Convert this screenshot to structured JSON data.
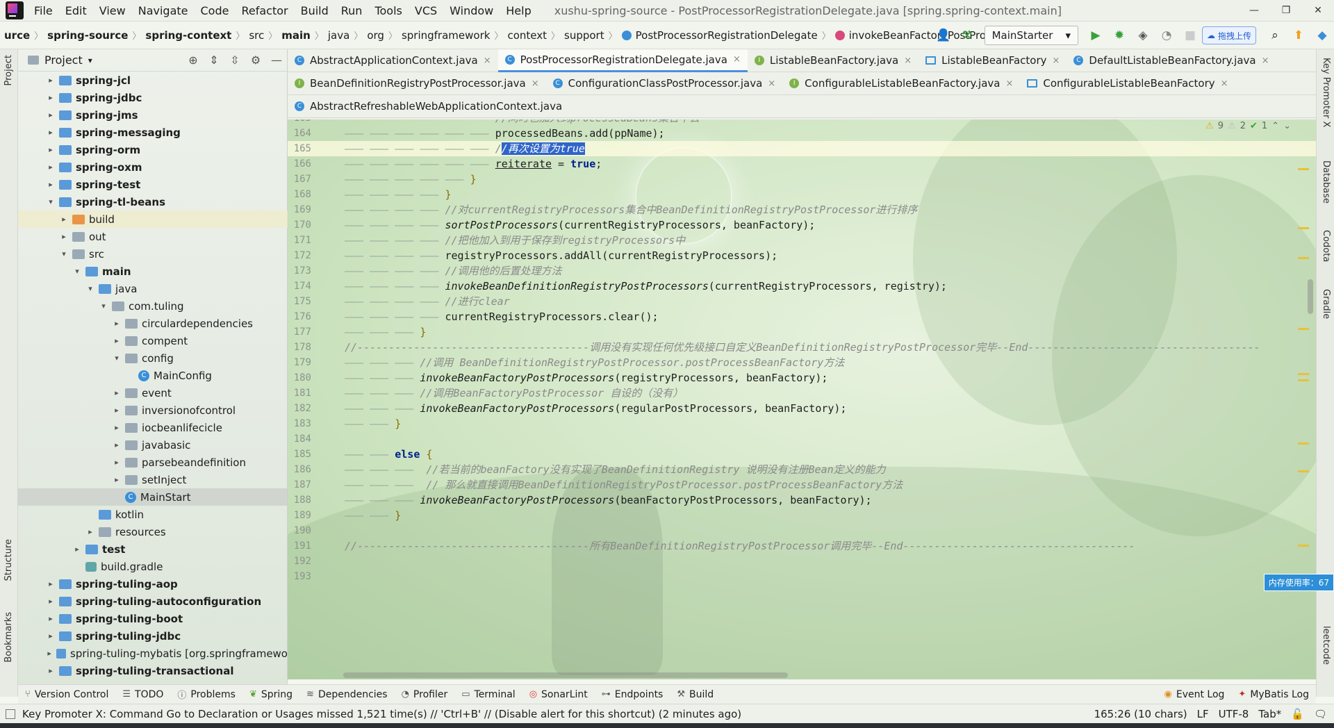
{
  "menu": {
    "items": [
      "File",
      "Edit",
      "View",
      "Navigate",
      "Code",
      "Refactor",
      "Build",
      "Run",
      "Tools",
      "VCS",
      "Window",
      "Help"
    ],
    "window_title": "xushu-spring-source - PostProcessorRegistrationDelegate.java [spring.spring-context.main]"
  },
  "nav": {
    "crumbs": [
      "urce",
      "spring-source",
      "spring-context",
      "src",
      "main",
      "java",
      "org",
      "springframework",
      "context",
      "support"
    ],
    "class_crumb": "PostProcessorRegistrationDelegate",
    "method_crumb": "invokeBeanFactoryPostProcessors",
    "run_config": "MainStarter",
    "baidu_label": "拖拽上传"
  },
  "project": {
    "title": "Project",
    "items": [
      {
        "label": "spring-jcl",
        "level": 1,
        "arrow": "▸",
        "icon": "mod",
        "bold": true
      },
      {
        "label": "spring-jdbc",
        "level": 1,
        "arrow": "▸",
        "icon": "mod",
        "bold": true
      },
      {
        "label": "spring-jms",
        "level": 1,
        "arrow": "▸",
        "icon": "mod",
        "bold": true
      },
      {
        "label": "spring-messaging",
        "level": 1,
        "arrow": "▸",
        "icon": "mod",
        "bold": true
      },
      {
        "label": "spring-orm",
        "level": 1,
        "arrow": "▸",
        "icon": "mod",
        "bold": true
      },
      {
        "label": "spring-oxm",
        "level": 1,
        "arrow": "▸",
        "icon": "mod",
        "bold": true
      },
      {
        "label": "spring-test",
        "level": 1,
        "arrow": "▸",
        "icon": "mod",
        "bold": true
      },
      {
        "label": "spring-tl-beans",
        "level": 1,
        "arrow": "▾",
        "icon": "mod",
        "bold": true
      },
      {
        "label": "build",
        "level": 2,
        "arrow": "▸",
        "icon": "orange",
        "bold": false,
        "highlight": true
      },
      {
        "label": "out",
        "level": 2,
        "arrow": "▸",
        "icon": "plain",
        "bold": false
      },
      {
        "label": "src",
        "level": 2,
        "arrow": "▾",
        "icon": "plain",
        "bold": false
      },
      {
        "label": "main",
        "level": 3,
        "arrow": "▾",
        "icon": "src",
        "bold": true
      },
      {
        "label": "java",
        "level": 4,
        "arrow": "▾",
        "icon": "src",
        "bold": false
      },
      {
        "label": "com.tuling",
        "level": 5,
        "arrow": "▾",
        "icon": "plain",
        "bold": false
      },
      {
        "label": "circulardependencies",
        "level": 6,
        "arrow": "▸",
        "icon": "plain",
        "bold": false
      },
      {
        "label": "compent",
        "level": 6,
        "arrow": "▸",
        "icon": "plain",
        "bold": false
      },
      {
        "label": "config",
        "level": 6,
        "arrow": "▾",
        "icon": "plain",
        "bold": false
      },
      {
        "label": "MainConfig",
        "level": 7,
        "arrow": "",
        "icon": "class",
        "bold": false
      },
      {
        "label": "event",
        "level": 6,
        "arrow": "▸",
        "icon": "plain",
        "bold": false
      },
      {
        "label": "inversionofcontrol",
        "level": 6,
        "arrow": "▸",
        "icon": "plain",
        "bold": false
      },
      {
        "label": "iocbeanlifecicle",
        "level": 6,
        "arrow": "▸",
        "icon": "plain",
        "bold": false
      },
      {
        "label": "javabasic",
        "level": 6,
        "arrow": "▸",
        "icon": "plain",
        "bold": false
      },
      {
        "label": "parsebeandefinition",
        "level": 6,
        "arrow": "▸",
        "icon": "plain",
        "bold": false
      },
      {
        "label": "setInject",
        "level": 6,
        "arrow": "▸",
        "icon": "plain",
        "bold": false
      },
      {
        "label": "MainStart",
        "level": 6,
        "arrow": "",
        "icon": "class",
        "bold": false,
        "selected": true
      },
      {
        "label": "kotlin",
        "level": 4,
        "arrow": "",
        "icon": "src",
        "bold": false
      },
      {
        "label": "resources",
        "level": 4,
        "arrow": "▸",
        "icon": "res",
        "bold": false
      },
      {
        "label": "test",
        "level": 3,
        "arrow": "▸",
        "icon": "src",
        "bold": true
      },
      {
        "label": "build.gradle",
        "level": 3,
        "arrow": "",
        "icon": "gradle",
        "bold": false
      },
      {
        "label": "spring-tuling-aop",
        "level": 1,
        "arrow": "▸",
        "icon": "mod",
        "bold": true
      },
      {
        "label": "spring-tuling-autoconfiguration",
        "level": 1,
        "arrow": "▸",
        "icon": "mod",
        "bold": true
      },
      {
        "label": "spring-tuling-boot",
        "level": 1,
        "arrow": "▸",
        "icon": "mod",
        "bold": true
      },
      {
        "label": "spring-tuling-jdbc",
        "level": 1,
        "arrow": "▸",
        "icon": "mod",
        "bold": true
      },
      {
        "label": "spring-tuling-mybatis [org.springframewo",
        "level": 1,
        "arrow": "▸",
        "icon": "mod",
        "bold": false
      },
      {
        "label": "spring-tuling-transactional",
        "level": 1,
        "arrow": "▸",
        "icon": "mod",
        "bold": true
      }
    ]
  },
  "tabs": {
    "row1": [
      {
        "label": "AbstractApplicationContext.java",
        "icon": "class"
      },
      {
        "label": "PostProcessorRegistrationDelegate.java",
        "icon": "class",
        "active": true
      },
      {
        "label": "ListableBeanFactory.java",
        "icon": "iface"
      },
      {
        "label": "ListableBeanFactory",
        "icon": "diagram",
        "close": true
      },
      {
        "label": "DefaultListableBeanFactory.java",
        "icon": "class"
      }
    ],
    "row2": [
      {
        "label": "BeanDefinitionRegistryPostProcessor.java",
        "icon": "iface"
      },
      {
        "label": "ConfigurationClassPostProcessor.java",
        "icon": "class"
      },
      {
        "label": "ConfigurableListableBeanFactory.java",
        "icon": "iface"
      },
      {
        "label": "ConfigurableListableBeanFactory",
        "icon": "diagram"
      }
    ],
    "row3": [
      {
        "label": "AbstractRefreshableWebApplicationContext.java",
        "icon": "class",
        "noclose": true
      }
    ]
  },
  "editor": {
    "inspections": {
      "warnings": "9",
      "weak": "2",
      "ok": "1"
    },
    "lines": [
      {
        "n": "163",
        "indent": 6,
        "html": "<span class='cm'>//同时也加入到processedBeans集合中去</span>"
      },
      {
        "n": "164",
        "indent": 6,
        "html": "processedBeans.add(ppName);"
      },
      {
        "n": "165",
        "indent": 6,
        "html": "<span class='cm'>/</span><span class='sel cm'>/再次设置为true</span>",
        "current": true
      },
      {
        "n": "166",
        "indent": 6,
        "html": "<span class='under'>reiterate</span> = <span class='kw'>true</span>;"
      },
      {
        "n": "167",
        "indent": 5,
        "html": "<span class='brace'>}</span>"
      },
      {
        "n": "168",
        "indent": 4,
        "html": "<span class='brace'>}</span>"
      },
      {
        "n": "169",
        "indent": 4,
        "html": "<span class='cm'>//对currentRegistryProcessors集合中BeanDefinitionRegistryPostProcessor进行排序</span>"
      },
      {
        "n": "170",
        "indent": 4,
        "html": "<span class='fn'>sortPostProcessors</span>(currentRegistryProcessors, beanFactory);"
      },
      {
        "n": "171",
        "indent": 4,
        "html": "<span class='cm'>//把他加入到用于保存到registryProcessors中</span>"
      },
      {
        "n": "172",
        "indent": 4,
        "html": "registryProcessors.addAll(currentRegistryProcessors);"
      },
      {
        "n": "173",
        "indent": 4,
        "html": "<span class='cm'>//调用他的后置处理方法</span>"
      },
      {
        "n": "174",
        "indent": 4,
        "html": "<span class='fn'>invokeBeanDefinitionRegistryPostProcessors</span>(currentRegistryProcessors, registry);"
      },
      {
        "n": "175",
        "indent": 4,
        "html": "<span class='cm'>//进行clear</span>"
      },
      {
        "n": "176",
        "indent": 4,
        "html": "currentRegistryProcessors.clear();"
      },
      {
        "n": "177",
        "indent": 3,
        "html": "<span class='brace'>}</span>"
      },
      {
        "n": "178",
        "indent": 0,
        "html": "<span class='cm'>//-------------------------------------调用没有实现任何优先级接口自定义BeanDefinitionRegistryPostProcessor完毕--End-------------------------------------</span>"
      },
      {
        "n": "179",
        "indent": 3,
        "html": "<span class='cm'>//调用 BeanDefinitionRegistryPostProcessor.postProcessBeanFactory方法</span>"
      },
      {
        "n": "180",
        "indent": 3,
        "html": "<span class='fn'>invokeBeanFactoryPostProcessors</span>(registryProcessors, beanFactory);"
      },
      {
        "n": "181",
        "indent": 3,
        "html": "<span class='cm'>//调用BeanFactoryPostProcessor 自设的（没有）</span>"
      },
      {
        "n": "182",
        "indent": 3,
        "html": "<span class='fn'>invokeBeanFactoryPostProcessors</span>(regularPostProcessors, beanFactory);"
      },
      {
        "n": "183",
        "indent": 2,
        "html": "<span class='brace'>}</span>"
      },
      {
        "n": "184",
        "indent": 0,
        "html": ""
      },
      {
        "n": "185",
        "indent": 2,
        "html": "<span class='kw'>else</span> <span class='brace'>{</span>"
      },
      {
        "n": "186",
        "indent": 3,
        "html": " <span class='cm'>//若当前的beanFactory没有实现了BeanDefinitionRegistry 说明没有注册Bean定义的能力</span>"
      },
      {
        "n": "187",
        "indent": 3,
        "html": " <span class='cm'>// 那么就直接调用BeanDefinitionRegistryPostProcessor.postProcessBeanFactory方法</span>"
      },
      {
        "n": "188",
        "indent": 3,
        "html": "<span class='fn'>invokeBeanFactoryPostProcessors</span>(beanFactoryPostProcessors, beanFactory);"
      },
      {
        "n": "189",
        "indent": 2,
        "html": "<span class='brace'>}</span>"
      },
      {
        "n": "190",
        "indent": 0,
        "html": ""
      },
      {
        "n": "191",
        "indent": 0,
        "html": "<span class='cm'>//-------------------------------------所有BeanDefinitionRegistryPostProcessor调用完毕--End-------------------------------------</span>"
      },
      {
        "n": "192",
        "indent": 0,
        "html": ""
      },
      {
        "n": "193",
        "indent": 0,
        "html": ""
      }
    ],
    "memory_badge": "内存使用率：67"
  },
  "toolwindows": {
    "left": [
      "Version Control",
      "TODO",
      "Problems",
      "Spring",
      "Dependencies",
      "Profiler",
      "Terminal",
      "SonarLint",
      "Endpoints",
      "Build"
    ],
    "right": [
      "Event Log",
      "MyBatis Log"
    ]
  },
  "side": {
    "left": [
      "Project",
      "Structure",
      "Bookmarks"
    ],
    "right": [
      "Key Promoter X",
      "Database",
      "Codota",
      "Gradle",
      "leetcode"
    ]
  },
  "status": {
    "message": "Key Promoter X: Command Go to Declaration or Usages missed 1,521 time(s) // 'Ctrl+B' // (Disable alert for this shortcut) (2 minutes ago)",
    "position": "165:26 (10 chars)",
    "line_sep": "LF",
    "encoding": "UTF-8",
    "indent": "Tab*"
  }
}
